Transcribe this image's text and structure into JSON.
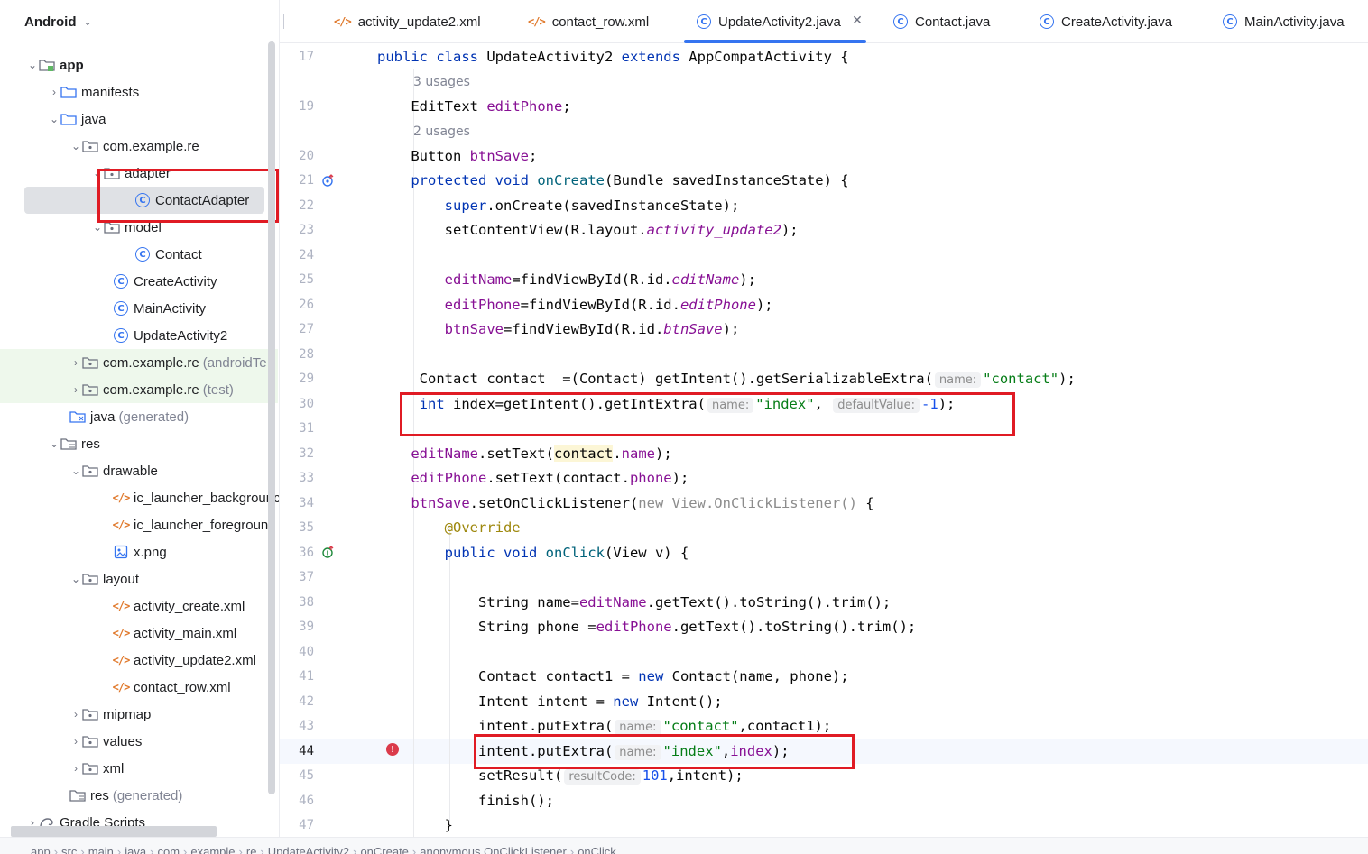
{
  "sidebar": {
    "view_label": "Android",
    "tree": [
      {
        "label": "app",
        "bold": true
      },
      {
        "label": "manifests"
      },
      {
        "label": "java"
      },
      {
        "label": "com.example.re"
      },
      {
        "label": "adapter"
      },
      {
        "label": "ContactAdapter"
      },
      {
        "label": "model"
      },
      {
        "label": "Contact"
      },
      {
        "label": "CreateActivity"
      },
      {
        "label": "MainActivity"
      },
      {
        "label": "UpdateActivity2"
      },
      {
        "label": "com.example.re",
        "suffix": "(androidTe"
      },
      {
        "label": "com.example.re",
        "suffix": "(test)"
      },
      {
        "label": "java",
        "suffix": "(generated)"
      },
      {
        "label": "res"
      },
      {
        "label": "drawable"
      },
      {
        "label": "ic_launcher_backgrounc"
      },
      {
        "label": "ic_launcher_foreground"
      },
      {
        "label": "x.png"
      },
      {
        "label": "layout"
      },
      {
        "label": "activity_create.xml"
      },
      {
        "label": "activity_main.xml"
      },
      {
        "label": "activity_update2.xml"
      },
      {
        "label": "contact_row.xml"
      },
      {
        "label": "mipmap"
      },
      {
        "label": "values"
      },
      {
        "label": "xml"
      },
      {
        "label": "res",
        "suffix": "(generated)"
      },
      {
        "label": "Gradle Scripts"
      }
    ]
  },
  "tabs": [
    {
      "label": "activity_update2.xml"
    },
    {
      "label": "contact_row.xml"
    },
    {
      "label": "UpdateActivity2.java"
    },
    {
      "label": "Contact.java"
    },
    {
      "label": "CreateActivity.java"
    },
    {
      "label": "MainActivity.java"
    }
  ],
  "editor": {
    "line_numbers": [
      "17",
      "19",
      "20",
      "21",
      "22",
      "23",
      "24",
      "25",
      "26",
      "27",
      "28",
      "29",
      "30",
      "31",
      "32",
      "33",
      "34",
      "35",
      "36",
      "37",
      "38",
      "39",
      "40",
      "41",
      "42",
      "43",
      "44",
      "45",
      "46",
      "47"
    ],
    "usages": [
      "3 usages",
      "2 usages"
    ],
    "hints": {
      "name": "name:",
      "default_value": "defaultValue:",
      "result_code": "resultCode:"
    }
  },
  "breadcrumb": [
    "app",
    "src",
    "main",
    "java",
    "com",
    "example",
    "re",
    "UpdateActivity2",
    "onCreate",
    "anonymous OnClickListener",
    "onClick"
  ],
  "colors": {
    "accent": "#3574f0",
    "highlight_box": "#e01b24",
    "error": "#db3b4b",
    "keyword": "#0033b3",
    "string": "#067d17",
    "field": "#871094"
  }
}
